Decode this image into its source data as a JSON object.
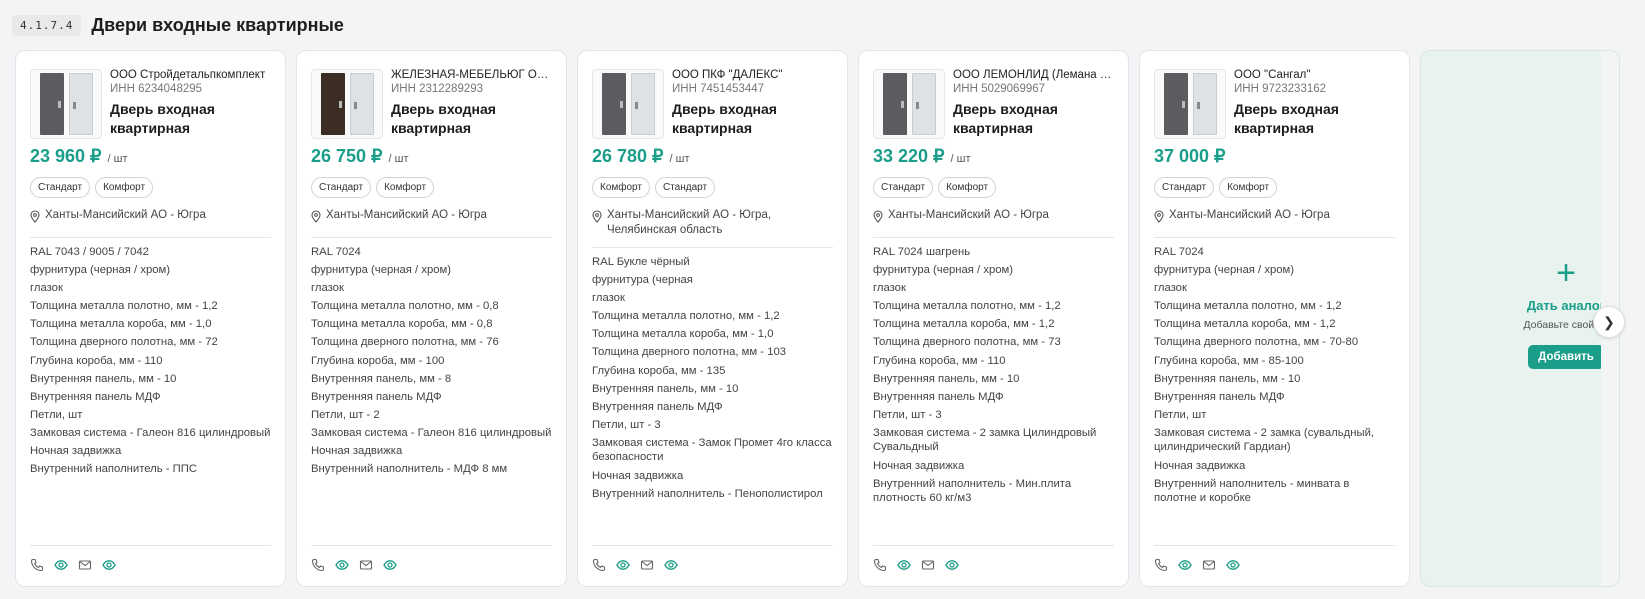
{
  "section": {
    "code": "4.1.7.4",
    "title": "Двери входные квартирные"
  },
  "cards": [
    {
      "vendor": "ООО Стройдетальпкомплект",
      "inn": "ИНН 6234048295",
      "product": "Дверь входная квартирная",
      "price": "23 960 ₽",
      "unit": "/ шт",
      "tags": [
        "Стандарт",
        "Комфорт"
      ],
      "location": "Ханты-Мансийский АО - Югра",
      "specs": [
        "RAL 7043 / 9005 / 7042",
        "фурнитура (черная / хром)",
        "глазок",
        "Толщина металла полотно, мм - 1,2",
        "Толщина металла короба, мм - 1,0",
        "Толщина дверного полотна, мм - 72",
        "Глубина короба, мм - 110",
        "Внутренняя панель, мм - 10",
        "Внутренняя панель МДФ",
        "Петли, шт",
        "Замковая система - Галеон 816 цилиндровый",
        "Ночная задвижка",
        "Внутренний наполнитель - ППС"
      ]
    },
    {
      "vendor": "ЖЕЛЕЗНАЯ-МЕБЕЛЬЮГ ООО",
      "inn": "ИНН 2312289293",
      "product": "Дверь входная квартирная",
      "price": "26 750 ₽",
      "unit": "/ шт",
      "tags": [
        "Стандарт",
        "Комфорт"
      ],
      "location": "Ханты-Мансийский АО - Югра",
      "specs": [
        "RAL 7024",
        "фурнитура (черная / хром)",
        "глазок",
        "Толщина металла полотно, мм - 0,8",
        "Толщина металла короба, мм - 0,8",
        "Толщина дверного полотна, мм - 76",
        "Глубина короба, мм - 100",
        "Внутренняя панель, мм - 8",
        "Внутренняя панель МДФ",
        "Петли, шт - 2",
        "Замковая система - Галеон 816 цилиндровый",
        "Ночная задвижка",
        "Внутренний наполнитель - МДФ 8 мм"
      ]
    },
    {
      "vendor": "ООО ПКФ \"ДАЛЕКС\"",
      "inn": "ИНН 7451453447",
      "product": "Дверь входная квартирная",
      "price": "26 780 ₽",
      "unit": "/ шт",
      "tags": [
        "Комфорт",
        "Стандарт"
      ],
      "location": "Ханты-Мансийский АО - Югра, Челябинская область",
      "specs": [
        "RAL Букле чёрный",
        "фурнитура (черная",
        "глазок",
        "Толщина металла полотно, мм - 1,2",
        "Толщина металла короба, мм - 1,0",
        "Толщина дверного полотна, мм - 103",
        "Глубина короба, мм - 135",
        "Внутренняя панель, мм - 10",
        "Внутренняя панель МДФ",
        "Петли, шт - 3",
        "Замковая система - Замок Промет 4го класса безопасности",
        "Ночная задвижка",
        "Внутренний наполнитель - Пенополистирол"
      ]
    },
    {
      "vendor": "ООО ЛЕМОНЛИД (Лемана П...",
      "inn": "ИНН 5029069967",
      "product": "Дверь входная квартирная",
      "price": "33 220 ₽",
      "unit": "/ шт",
      "tags": [
        "Стандарт",
        "Комфорт"
      ],
      "location": "Ханты-Мансийский АО - Югра",
      "specs": [
        "RAL 7024 шагрень",
        "фурнитура (черная / хром)",
        "глазок",
        "Толщина металла полотно, мм - 1,2",
        "Толщина металла короба, мм - 1,2",
        "Толщина дверного полотна, мм - 73",
        "Глубина короба, мм - 110",
        "Внутренняя панель, мм - 10",
        "Внутренняя панель МДФ",
        "Петли, шт - 3",
        "Замковая система - 2 замка Цилиндровый Сувальдный",
        "Ночная задвижка",
        "Внутренний наполнитель - Мин.плита плотность 60 кг/м3"
      ]
    },
    {
      "vendor": "ООО \"Сангал\"",
      "inn": "ИНН 9723233162",
      "product": "Дверь входная квартирная",
      "price": "37 000 ₽",
      "unit": "",
      "tags": [
        "Стандарт",
        "Комфорт"
      ],
      "location": "Ханты-Мансийский АО - Югра",
      "specs": [
        "RAL 7024",
        "фурнитура (черная / хром)",
        "глазок",
        "Толщина металла полотно, мм - 1,2",
        "Толщина металла короба, мм - 1,2",
        "Толщина дверного полотна, мм - 70-80",
        "Глубина короба, мм - 85-100",
        "Внутренняя панель, мм - 10",
        "Внутренняя панель МДФ",
        "Петли, шт",
        "Замковая система - 2 замка (сувальдный, цилиндрический Гардиан)",
        "Ночная задвижка",
        "Внутренний наполнитель - минвата в полотне и коробке"
      ]
    }
  ],
  "add_card": {
    "title": "Дать аналог",
    "subtitle": "Добавьте свой пр",
    "button": "Добавить"
  },
  "icons": [
    "phone-icon",
    "eye-icon",
    "mail-icon",
    "eye-icon"
  ],
  "colors": {
    "accent": "#1a9e8a",
    "background": "#f3f4f5",
    "add_card_bg": "#e8f3f0"
  }
}
